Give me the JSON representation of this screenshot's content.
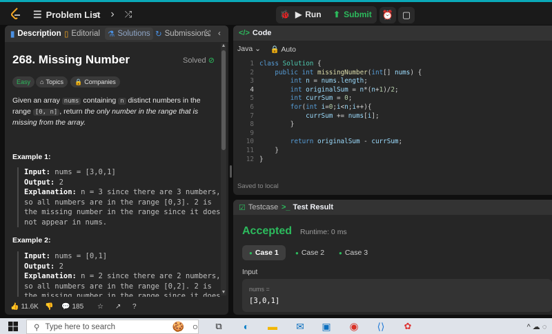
{
  "topbar": {
    "problem_list": "Problem List",
    "run": "Run",
    "submit": "Submit"
  },
  "left_tabs": {
    "description": "Description",
    "editorial": "Editorial",
    "solutions": "Solutions",
    "submissions": "Submissions"
  },
  "problem": {
    "title": "268. Missing Number",
    "status": "Solved",
    "difficulty": "Easy",
    "topics": "Topics",
    "companies": "Companies",
    "desc_1": "Given an array ",
    "desc_nums": "nums",
    "desc_2": " containing ",
    "desc_n": "n",
    "desc_3": " distinct numbers in the range ",
    "desc_range": "[0, n]",
    "desc_4": ", return ",
    "desc_5": "the only number in the range that is missing from the array.",
    "example1_title": "Example 1:",
    "example1": {
      "input_label": "Input:",
      "input": " nums = [3,0,1]",
      "output_label": "Output:",
      "output": " 2",
      "explanation_label": "Explanation:",
      "explanation": " n = 3 since there are 3 numbers, so all numbers are in the range [0,3]. 2 is the missing number in the range since it does not appear in nums."
    },
    "example2_title": "Example 2:",
    "example2": {
      "input_label": "Input:",
      "input": " nums = [0,1]",
      "output_label": "Output:",
      "output": " 2",
      "explanation_label": "Explanation:",
      "explanation": " n = 2 since there are 2 numbers, so all numbers are in the range [0,2]. 2 is the missing number in the range since it does"
    }
  },
  "footer": {
    "likes": "11.6K",
    "comments": "185"
  },
  "code": {
    "header": "Code",
    "language": "Java",
    "mode": "Auto",
    "line_numbers": [
      "1",
      "2",
      "3",
      "4",
      "5",
      "6",
      "7",
      "8",
      "9",
      "10",
      "11",
      "12"
    ],
    "saved": "Saved to local"
  },
  "result": {
    "testcase_tab": "Testcase",
    "result_tab": "Test Result",
    "status": "Accepted",
    "runtime": "Runtime: 0 ms",
    "cases": [
      "Case 1",
      "Case 2",
      "Case 3"
    ],
    "input_label": "Input",
    "var_name": "nums =",
    "var_value": "[3,0,1]"
  },
  "taskbar": {
    "search_placeholder": "Type here to search"
  },
  "colors": {
    "accent_green": "#2cbb5d",
    "brand_orange": "#f5a623",
    "top_stripe": "#0aa9b8"
  }
}
